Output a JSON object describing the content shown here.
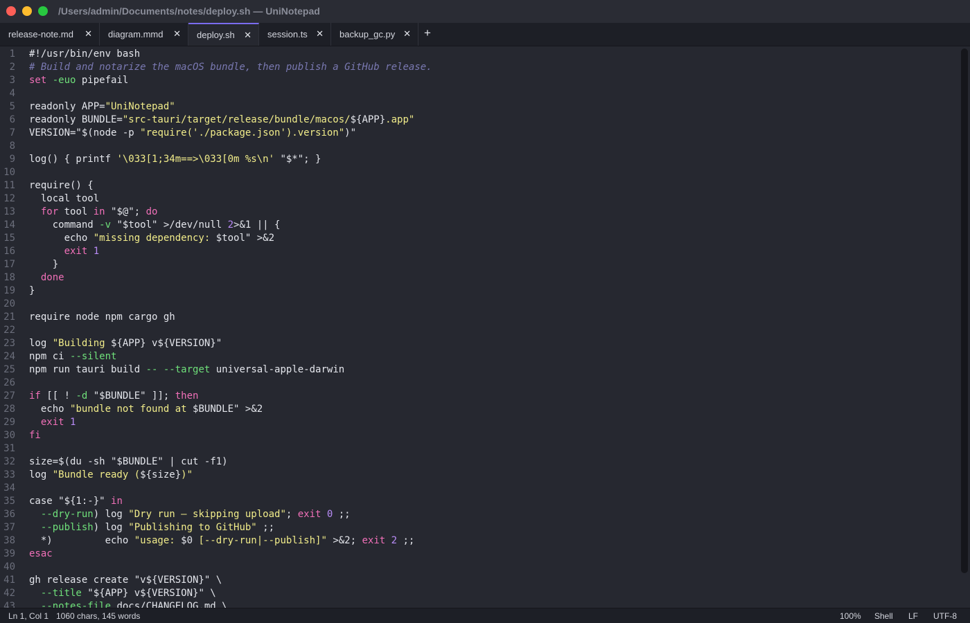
{
  "window": {
    "title": "/Users/admin/Documents/notes/deploy.sh — UniNotepad"
  },
  "tabs": [
    {
      "label": "release-note.md",
      "close": "✕",
      "active": false
    },
    {
      "label": "diagram.mmd",
      "close": "✕",
      "active": false
    },
    {
      "label": "deploy.sh",
      "close": "✕",
      "active": true
    },
    {
      "label": "session.ts",
      "close": "✕",
      "active": false
    },
    {
      "label": "backup_gc.py",
      "close": "✕",
      "active": false
    }
  ],
  "new_tab_label": "+",
  "colors": {
    "keyword": "#f070b8",
    "string": "#f1ec8a",
    "comment": "#7a79b2",
    "number": "#b98cf7",
    "flag": "#6fe07a",
    "accent_tab": "#7a6cf0"
  },
  "editor": {
    "lines": [
      [
        [
          "plain",
          "#!/usr/bin/env bash"
        ]
      ],
      [
        [
          "cm",
          "# Build and notarize the macOS bundle, then publish a GitHub release."
        ]
      ],
      [
        [
          "kw",
          "set"
        ],
        [
          "plain",
          " "
        ],
        [
          "flag",
          "-euo"
        ],
        [
          "plain",
          " pipefail"
        ]
      ],
      [],
      [
        [
          "plain",
          "readonly APP="
        ],
        [
          "str",
          "\"UniNotepad\""
        ]
      ],
      [
        [
          "plain",
          "readonly BUNDLE="
        ],
        [
          "str",
          "\"src-tauri/target/release/bundle/macos/"
        ],
        [
          "plain",
          "${APP}"
        ],
        [
          "str",
          ".app\""
        ]
      ],
      [
        [
          "plain",
          "VERSION=\"$(node -p "
        ],
        [
          "str",
          "\"require('./package.json').version\""
        ],
        [
          "plain",
          ")\""
        ]
      ],
      [],
      [
        [
          "plain",
          "log() { printf "
        ],
        [
          "str",
          "'\\033[1;34m==>\\033[0m %s\\n'"
        ],
        [
          "plain",
          " \"$*\"; }"
        ]
      ],
      [],
      [
        [
          "plain",
          "require() {"
        ]
      ],
      [
        [
          "plain",
          "  local tool"
        ]
      ],
      [
        [
          "plain",
          "  "
        ],
        [
          "kw",
          "for"
        ],
        [
          "plain",
          " tool "
        ],
        [
          "kw",
          "in"
        ],
        [
          "plain",
          " \"$@\"; "
        ],
        [
          "kw",
          "do"
        ]
      ],
      [
        [
          "plain",
          "    command "
        ],
        [
          "flag",
          "-v"
        ],
        [
          "plain",
          " \"$tool\" >/dev/null "
        ],
        [
          "num",
          "2"
        ],
        [
          "plain",
          ">&1 || {"
        ]
      ],
      [
        [
          "plain",
          "      echo "
        ],
        [
          "str",
          "\"missing dependency: "
        ],
        [
          "plain",
          "$tool\" >&2"
        ]
      ],
      [
        [
          "plain",
          "      "
        ],
        [
          "kw",
          "exit"
        ],
        [
          "plain",
          " "
        ],
        [
          "num",
          "1"
        ]
      ],
      [
        [
          "plain",
          "    }"
        ]
      ],
      [
        [
          "plain",
          "  "
        ],
        [
          "kw",
          "done"
        ]
      ],
      [
        [
          "plain",
          "}"
        ]
      ],
      [],
      [
        [
          "plain",
          "require node npm cargo gh"
        ]
      ],
      [],
      [
        [
          "plain",
          "log "
        ],
        [
          "str",
          "\"Building "
        ],
        [
          "plain",
          "${APP} v${VERSION}\""
        ]
      ],
      [
        [
          "plain",
          "npm ci "
        ],
        [
          "flag",
          "--silent"
        ]
      ],
      [
        [
          "plain",
          "npm run tauri build "
        ],
        [
          "flag",
          "--"
        ],
        [
          "plain",
          " "
        ],
        [
          "flag",
          "--target"
        ],
        [
          "plain",
          " universal-apple-darwin"
        ]
      ],
      [],
      [
        [
          "kw",
          "if"
        ],
        [
          "plain",
          " [[ ! "
        ],
        [
          "flag",
          "-d"
        ],
        [
          "plain",
          " \"$BUNDLE\" ]]; "
        ],
        [
          "kw",
          "then"
        ]
      ],
      [
        [
          "plain",
          "  echo "
        ],
        [
          "str",
          "\"bundle not found at "
        ],
        [
          "plain",
          "$BUNDLE\" >&2"
        ]
      ],
      [
        [
          "plain",
          "  "
        ],
        [
          "kw",
          "exit"
        ],
        [
          "plain",
          " "
        ],
        [
          "num",
          "1"
        ]
      ],
      [
        [
          "kw",
          "fi"
        ]
      ],
      [],
      [
        [
          "plain",
          "size=$(du -sh \"$BUNDLE\" | cut -f1)"
        ]
      ],
      [
        [
          "plain",
          "log "
        ],
        [
          "str",
          "\"Bundle ready ("
        ],
        [
          "plain",
          "${size}"
        ],
        [
          "str",
          ")\""
        ]
      ],
      [],
      [
        [
          "plain",
          "case \"${1:-}\" "
        ],
        [
          "kw",
          "in"
        ]
      ],
      [
        [
          "plain",
          "  "
        ],
        [
          "flag",
          "--dry-run"
        ],
        [
          "plain",
          ") log "
        ],
        [
          "str",
          "\"Dry run — skipping upload\""
        ],
        [
          "plain",
          "; "
        ],
        [
          "kw",
          "exit"
        ],
        [
          "plain",
          " "
        ],
        [
          "num",
          "0"
        ],
        [
          "plain",
          " ;;"
        ]
      ],
      [
        [
          "plain",
          "  "
        ],
        [
          "flag",
          "--publish"
        ],
        [
          "plain",
          ") log "
        ],
        [
          "str",
          "\"Publishing to GitHub\""
        ],
        [
          "plain",
          " ;;"
        ]
      ],
      [
        [
          "plain",
          "  *)         echo "
        ],
        [
          "str",
          "\"usage: "
        ],
        [
          "plain",
          "$0 "
        ],
        [
          "str",
          "[--dry-run|--publish]\""
        ],
        [
          "plain",
          " >&2; "
        ],
        [
          "kw",
          "exit"
        ],
        [
          "plain",
          " "
        ],
        [
          "num",
          "2"
        ],
        [
          "plain",
          " ;;"
        ]
      ],
      [
        [
          "kw",
          "esac"
        ]
      ],
      [],
      [
        [
          "plain",
          "gh release create \"v${VERSION}\" \\"
        ]
      ],
      [
        [
          "plain",
          "  "
        ],
        [
          "flag",
          "--title"
        ],
        [
          "plain",
          " \"${APP} v${VERSION}\" \\"
        ]
      ],
      [
        [
          "plain",
          "  "
        ],
        [
          "flag",
          "--notes-file"
        ],
        [
          "plain",
          " docs/CHANGELOG.md \\"
        ]
      ]
    ]
  },
  "status": {
    "position": "Ln 1, Col 1",
    "counts": "1060 chars, 145 words",
    "zoom": "100%",
    "language": "Shell",
    "line_ending": "LF",
    "encoding": "UTF-8"
  }
}
